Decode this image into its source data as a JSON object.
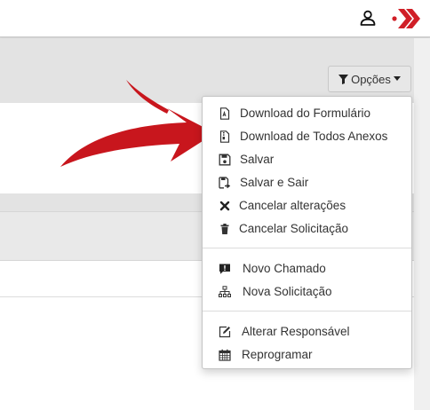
{
  "topbar": {
    "user_icon": "user-icon",
    "logo_icon": "double-chevron-logo",
    "logo_color": "#d01f27"
  },
  "options_button": {
    "label": "Opções",
    "icon": "filter-icon"
  },
  "menu": {
    "group1": [
      {
        "label": "Download do Formulário",
        "icon": "file-pdf-icon"
      },
      {
        "label": "Download de Todos Anexos",
        "icon": "file-archive-icon"
      },
      {
        "label": "Salvar",
        "icon": "floppy-disk-icon"
      },
      {
        "label": "Salvar e Sair",
        "icon": "save-exit-icon"
      },
      {
        "label": "Cancelar alterações",
        "icon": "close-x-icon"
      },
      {
        "label": "Cancelar Solicitação",
        "icon": "trash-icon"
      }
    ],
    "group2": [
      {
        "label": "Novo Chamado",
        "icon": "comment-alert-icon"
      },
      {
        "label": "Nova Solicitação",
        "icon": "sitemap-icon"
      }
    ],
    "group3": [
      {
        "label": "Alterar Responsável",
        "icon": "edit-pencil-icon"
      },
      {
        "label": "Reprogramar",
        "icon": "calendar-icon"
      }
    ]
  },
  "colors": {
    "arrow": "#c8161d",
    "accent": "#d01f27"
  }
}
